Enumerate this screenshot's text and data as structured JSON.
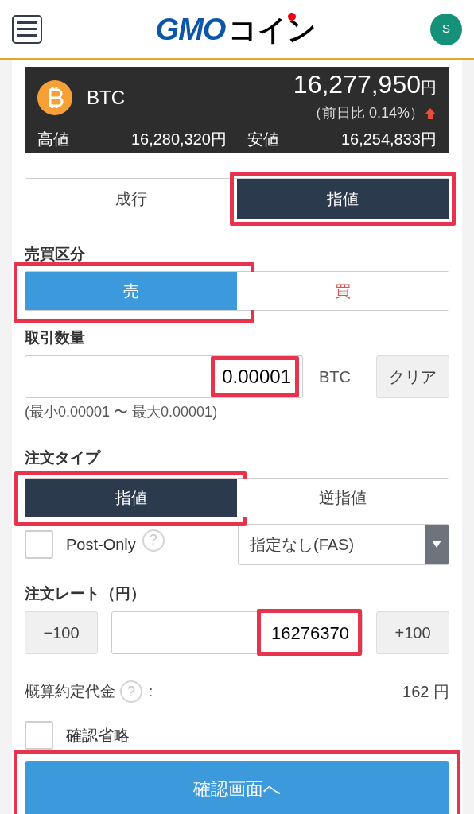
{
  "header": {
    "avatar": "S",
    "logo": {
      "brand": "GMO",
      "suffix": "コイン"
    }
  },
  "ticker": {
    "symbol": "BTC",
    "price": "16,277,950",
    "price_unit": "円",
    "change": "（前日比 0.14%）",
    "high_label": "高値",
    "high": "16,280,320円",
    "low_label": "安値",
    "low": "16,254,833円"
  },
  "order_tabs": [
    {
      "label": "成行",
      "selected": false,
      "highlighted": false
    },
    {
      "label": "指値",
      "selected": true,
      "highlighted": true
    }
  ],
  "side": {
    "label": "売買区分",
    "options": [
      {
        "label": "売",
        "selected": true,
        "kind": "sell",
        "highlighted": true
      },
      {
        "label": "買",
        "selected": false,
        "kind": "buy",
        "highlighted": false
      }
    ]
  },
  "quantity": {
    "label": "取引数量",
    "value": "0.00001",
    "highlighted": true,
    "unit": "BTC",
    "clear_button": "クリア",
    "range": "(最小0.00001 〜 最大0.00001)"
  },
  "order_type": {
    "label": "注文タイプ",
    "options": [
      {
        "label": "指値",
        "selected": true,
        "highlighted": true
      },
      {
        "label": "逆指値",
        "selected": false,
        "highlighted": false
      }
    ]
  },
  "post_only": {
    "label": "Post-Only",
    "checked": false,
    "help": "?"
  },
  "time_in_force": {
    "value": "指定なし(FAS)"
  },
  "rate": {
    "label": "注文レート（円）",
    "minus": "−100",
    "value": "16276370",
    "highlighted": true,
    "plus": "+100"
  },
  "estimate": {
    "label": "概算約定代金",
    "help": "?",
    "colon": ":",
    "value": "162 円"
  },
  "skip_confirm": {
    "label": "確認省略",
    "checked": false
  },
  "submit": {
    "label": "確認画面へ",
    "highlighted": true
  }
}
